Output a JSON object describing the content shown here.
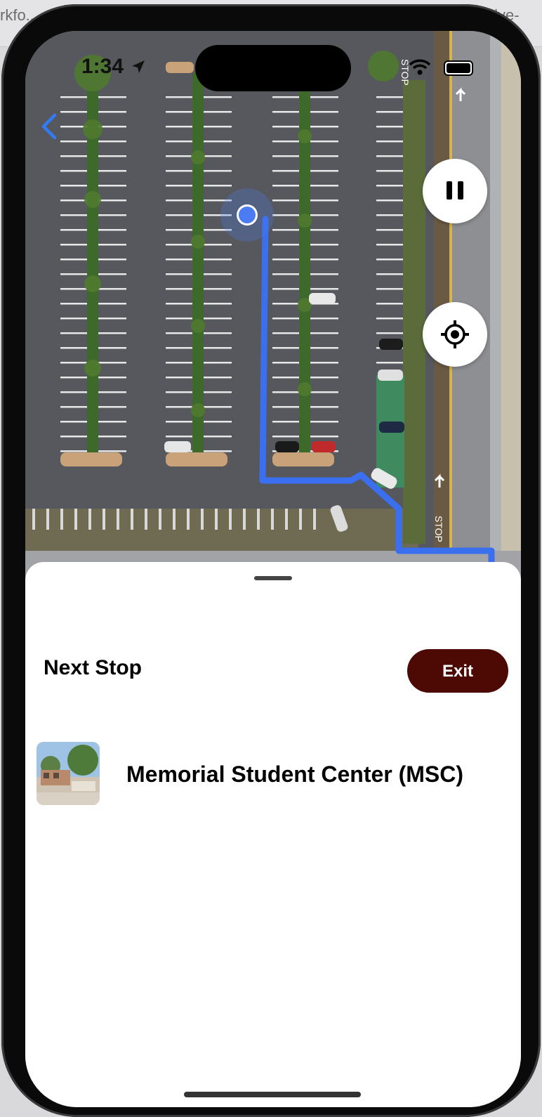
{
  "background": {
    "left_tab_text": "rkfo...",
    "right_tab_text": "welve-"
  },
  "status_bar": {
    "time": "1:34"
  },
  "map": {
    "icons": [
      "back-chevron-icon",
      "location-arrow-icon",
      "wifi-icon",
      "battery-icon",
      "pause-icon",
      "recenter-crosshair-icon",
      "user-location-dot-icon"
    ],
    "route_color": "#3a6ff0",
    "road_text_1": "STOP",
    "road_text_2": "STOP"
  },
  "sheet": {
    "title": "Next Stop",
    "exit_label": "Exit",
    "stop_name": "Memorial Student Center (MSC)"
  },
  "colors": {
    "accent": "#4d0a05",
    "link": "#2f7cf6"
  }
}
